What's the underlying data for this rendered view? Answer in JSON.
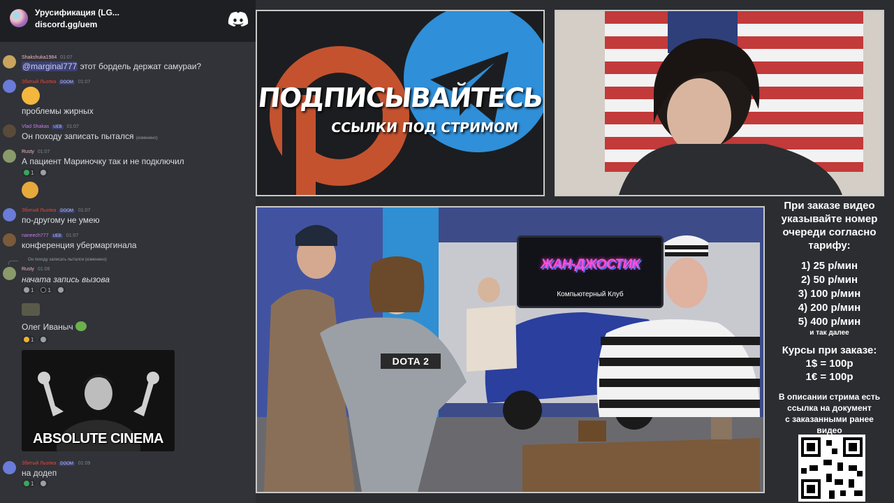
{
  "discord": {
    "server_name": "Урусификация (LG...",
    "invite": "discord.gg/uem",
    "messages": [
      {
        "user": "Shakshuka1984",
        "time": "01:07",
        "mention": "@marginal777",
        "text": " этот бордель держат самураи?"
      },
      {
        "user": "Збитый Льопка",
        "badge": "DOOM",
        "time": "01:07",
        "text": "проблемы жирных"
      },
      {
        "user": "Vlad Shakas",
        "badge": "UEB",
        "time": "01:07",
        "text": "Он походу записать пытался",
        "suffix": "(изменено)"
      },
      {
        "user": "Rusty",
        "time": "01:07",
        "text": "А пациент Мариночку так и не подключил",
        "react_count": "1"
      },
      {
        "user": "Збитый Льопка",
        "badge": "DOOM",
        "time": "01:07",
        "text": "по-другому не умею"
      },
      {
        "user": "naneech777",
        "badge": "UEB",
        "time": "01:07",
        "text": "конференция убермаргинала"
      },
      {
        "reply_to": "Он походу записать пытался",
        "reply_suffix": "(изменено)",
        "user": "Rusty",
        "time": "01:08",
        "text": "начата запись вызова",
        "react_counts": [
          "1",
          "1"
        ]
      },
      {
        "text": "Олег Иваныч",
        "react_count": "1"
      },
      {
        "image_caption": "ABSOLUTE CINEMA"
      },
      {
        "user": "Збитый Льопка",
        "badge": "DOOM",
        "time": "01:09",
        "text": "на додеп",
        "react_count": "1"
      }
    ]
  },
  "banner": {
    "title": "ПОДПИСЫВАЙТЕСЬ",
    "subtitle": "ССЫЛКИ ПОД СТРИМОМ",
    "colors": {
      "patreon": "#c4522f",
      "telegram": "#2f8fd8"
    }
  },
  "video": {
    "club_name": "ЖАН-ДЖОСТИК",
    "club_sub": "Компьютерный Клуб",
    "shirt_text": "DOTA 2"
  },
  "pricing": {
    "intro": [
      "При заказе видео",
      "указывайте номер",
      "очереди согласно",
      "тарифу:"
    ],
    "tiers": [
      "1) 25 р/мин",
      "2) 50 р/мин",
      "3) 100 р/мин",
      "4) 200 р/мин",
      "5) 400 р/мин"
    ],
    "etc": "и так далее",
    "rates_title": "Курсы при заказе:",
    "rates": [
      "1$ = 100р",
      "1€ = 100р"
    ],
    "footer": [
      "В описании стрима есть",
      "ссылка на документ",
      "с заказанными ранее",
      "видео"
    ]
  }
}
